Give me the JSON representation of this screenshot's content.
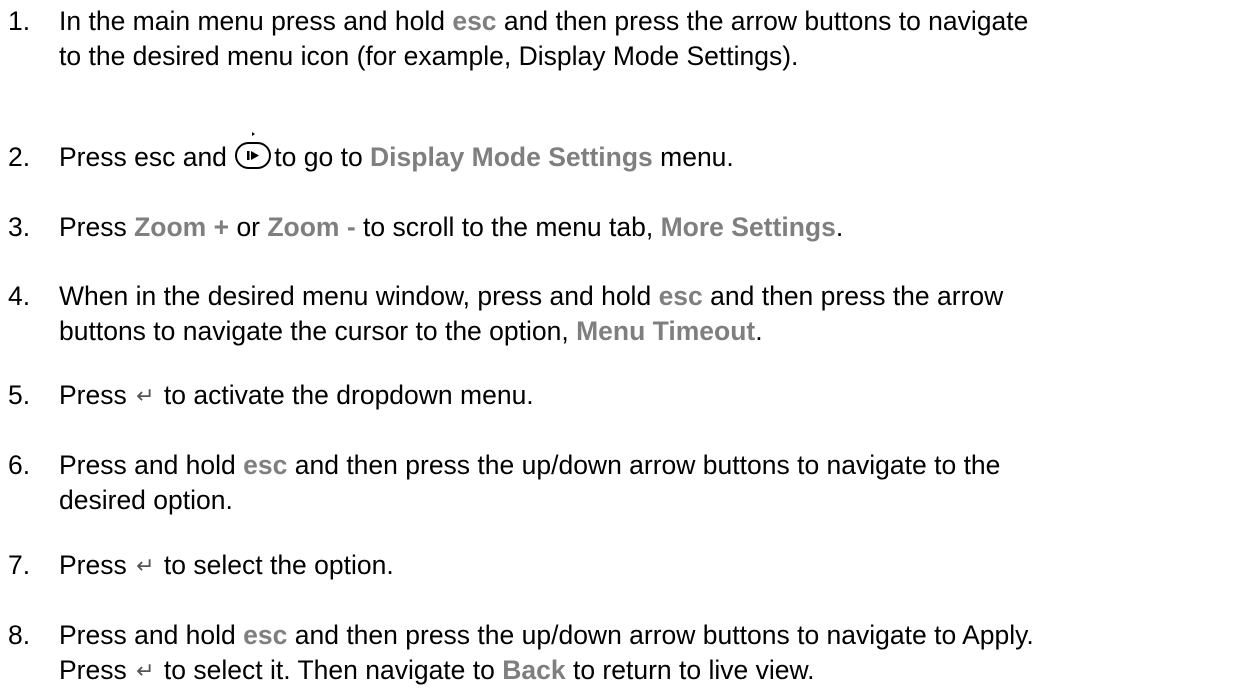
{
  "instructions": [
    {
      "number": "1.",
      "lines": [
        [
          "In the main menu press and hold ",
          {
            "kw": "esc"
          },
          " and then press the arrow buttons to navigate"
        ],
        [
          "to the desired menu icon (for example, Display Mode Settings)."
        ]
      ]
    },
    {
      "number": "2.",
      "lines": [
        [
          "Press esc and ",
          {
            "icon": "play-button-icon"
          },
          "to go to ",
          {
            "kw": "Display Mode Settings"
          },
          " menu."
        ]
      ]
    },
    {
      "number": "3.",
      "lines": [
        [
          "Press ",
          {
            "kw": "Zoom +"
          },
          "  or ",
          {
            "kw": "Zoom -"
          },
          "  to scroll to the menu tab, ",
          {
            "kw": "More Settings"
          },
          "."
        ]
      ]
    },
    {
      "number": "4.",
      "lines": [
        [
          "When in the desired menu window, press and hold ",
          {
            "kw": "esc"
          },
          " and then press the arrow"
        ],
        [
          "buttons to navigate the cursor to the option, ",
          {
            "kw": "Menu Timeout"
          },
          "."
        ]
      ]
    },
    {
      "number": "5.",
      "lines": [
        [
          "Press ",
          {
            "enter": "↵"
          },
          " to activate the dropdown menu."
        ]
      ]
    },
    {
      "number": "6.",
      "lines": [
        [
          "Press and hold ",
          {
            "kw": "esc"
          },
          " and then press the up/down arrow buttons to navigate to the"
        ],
        [
          "desired option."
        ]
      ]
    },
    {
      "number": "7.",
      "lines": [
        [
          "Press ",
          {
            "enter": "↵"
          },
          " to select the option."
        ]
      ]
    },
    {
      "number": "8.",
      "lines": [
        [
          "Press and hold ",
          {
            "kw": "esc"
          },
          " and then press the up/down arrow buttons to navigate to Apply."
        ],
        [
          "Press ",
          {
            "enter": "↵"
          },
          " to select it. Then navigate to ",
          {
            "kw": "Back"
          },
          " to return to live view."
        ]
      ]
    }
  ],
  "colors": {
    "keyword": "#7f7f7f",
    "text": "#000000"
  }
}
